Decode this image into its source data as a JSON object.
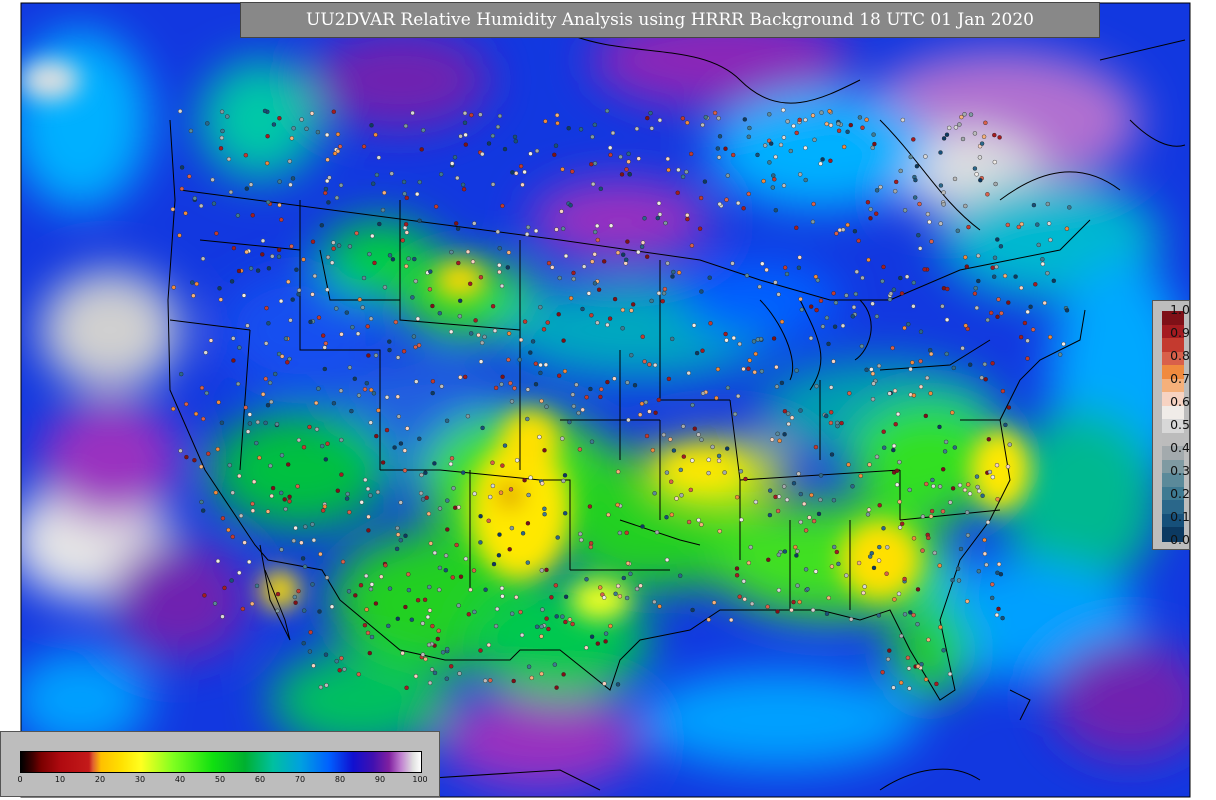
{
  "title": "UU2DVAR Relative Humidity Analysis using HRRR Background 18 UTC 01 Jan 2020",
  "observation_legend": {
    "labels": [
      "1.0",
      "0.9",
      "0.8",
      "0.7",
      "0.6",
      "0.5",
      "0.4",
      "0.3",
      "0.2",
      "0.1",
      "0.0"
    ],
    "colors": [
      "#7f1017",
      "#a51b20",
      "#c43a2f",
      "#d9604a",
      "#f08a3e",
      "#f5b07a",
      "#f7d3c2",
      "#f0ece8",
      "#d8d8d8",
      "#bcbcbc",
      "#a3aaad",
      "#7f9aa2",
      "#5b8a9a",
      "#3e7a92",
      "#2a678a",
      "#16507a",
      "#0c3a62"
    ]
  },
  "colorbar": {
    "ticks": [
      "0",
      "10",
      "20",
      "30",
      "40",
      "50",
      "60",
      "70",
      "80",
      "90",
      "100"
    ],
    "stops": [
      {
        "v": 0,
        "c": "#000000"
      },
      {
        "v": 3,
        "c": "#400000"
      },
      {
        "v": 5,
        "c": "#7a0000"
      },
      {
        "v": 10,
        "c": "#b00a10"
      },
      {
        "v": 17,
        "c": "#c41a1a"
      },
      {
        "v": 18,
        "c": "#e06030"
      },
      {
        "v": 20,
        "c": "#ffc000"
      },
      {
        "v": 25,
        "c": "#ffe000"
      },
      {
        "v": 30,
        "c": "#ffff20"
      },
      {
        "v": 38,
        "c": "#80ff20"
      },
      {
        "v": 48,
        "c": "#10e010"
      },
      {
        "v": 56,
        "c": "#00b030"
      },
      {
        "v": 63,
        "c": "#00c0a0"
      },
      {
        "v": 70,
        "c": "#00a0e0"
      },
      {
        "v": 77,
        "c": "#0060ff"
      },
      {
        "v": 83,
        "c": "#1010d0"
      },
      {
        "v": 88,
        "c": "#4010b0"
      },
      {
        "v": 92,
        "c": "#8020a0"
      },
      {
        "v": 95,
        "c": "#c080d0"
      },
      {
        "v": 98,
        "c": "#e0e0e0"
      },
      {
        "v": 100,
        "c": "#ffffff"
      }
    ]
  }
}
